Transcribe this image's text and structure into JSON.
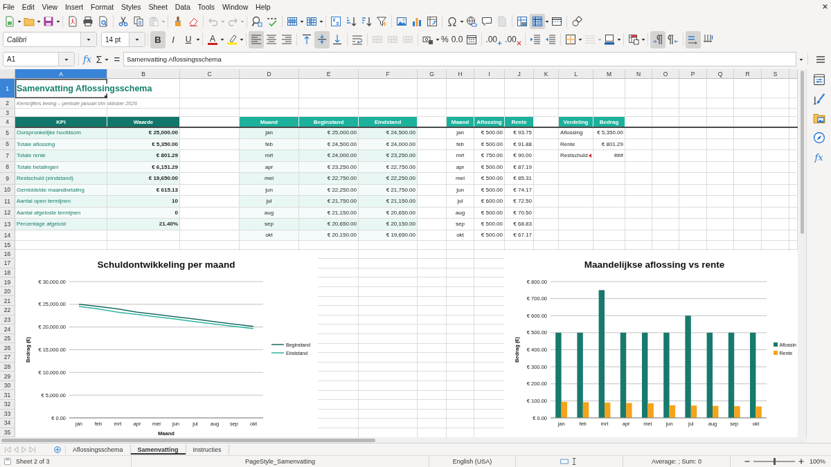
{
  "menu": [
    "File",
    "Edit",
    "View",
    "Insert",
    "Format",
    "Styles",
    "Sheet",
    "Data",
    "Tools",
    "Window",
    "Help"
  ],
  "standard_toolbar": {
    "paste": {
      "disabled": true
    },
    "undo": {
      "disabled": true
    },
    "redo": {
      "disabled": true
    },
    "header_footer": {
      "disabled": true
    },
    "freeze_rows_columns": {
      "on": true
    }
  },
  "formatting_toolbar": {
    "font_name": "Calibri",
    "font_size": "14 pt",
    "bold": {
      "label": "B",
      "on": true
    },
    "italic": {
      "label": "I",
      "on": false
    },
    "underline": {
      "label": "U",
      "on": false
    },
    "font_color": {
      "label": "A"
    },
    "align_left": {
      "on": true
    },
    "align_center": {
      "on": false
    },
    "align_right": {
      "on": false
    },
    "align_top": {
      "on": false
    },
    "align_center_vertically": {
      "on": true
    },
    "align_bottom": {
      "on": false
    },
    "merge_and_center": {
      "disabled": true
    },
    "merge_cells": {
      "disabled": true
    },
    "unmerge_cells": {
      "disabled": true
    },
    "percent": {
      "label": "%"
    },
    "number": {
      "label": "0.0"
    },
    "add_decimal_place": {
      "label": ".00"
    },
    "delete_decimal_place": {
      "label": ".00"
    },
    "border_style": {
      "disabled": true
    },
    "left_to_right": {
      "on": true
    },
    "right_to_left": {
      "on": false
    },
    "text_horizontal": {
      "on": true
    },
    "text_vertical": {
      "on": false
    }
  },
  "formula_bar": {
    "name_box": "A1",
    "function_wizard": "fx",
    "sum": "Σ",
    "equals": "=",
    "content": "Samenvatting Aflossingsschema"
  },
  "sidebar": {
    "functions": "fx"
  },
  "columns": [
    {
      "label": "A",
      "selected": true
    },
    {
      "label": "B",
      "selected": false
    },
    {
      "label": "C",
      "selected": false
    },
    {
      "label": "D",
      "selected": false
    },
    {
      "label": "E",
      "selected": false
    },
    {
      "label": "F",
      "selected": false
    },
    {
      "label": "G",
      "selected": false
    },
    {
      "label": "H",
      "selected": false
    },
    {
      "label": "I",
      "selected": false
    },
    {
      "label": "J",
      "selected": false
    },
    {
      "label": "K",
      "selected": false
    },
    {
      "label": "L",
      "selected": false
    },
    {
      "label": "M",
      "selected": false
    },
    {
      "label": "N",
      "selected": false
    },
    {
      "label": "O",
      "selected": false
    },
    {
      "label": "P",
      "selected": false
    },
    {
      "label": "Q",
      "selected": false
    },
    {
      "label": "R",
      "selected": false
    },
    {
      "label": "S",
      "selected": false
    }
  ],
  "rows": [
    {
      "label": "1",
      "selected": true
    },
    {
      "label": "2",
      "selected": false
    },
    {
      "label": "3",
      "selected": false
    },
    {
      "label": "4",
      "selected": false
    },
    {
      "label": "5",
      "selected": false
    },
    {
      "label": "6",
      "selected": false
    },
    {
      "label": "7",
      "selected": false
    },
    {
      "label": "8",
      "selected": false
    },
    {
      "label": "9",
      "selected": false
    },
    {
      "label": "10",
      "selected": false
    },
    {
      "label": "11",
      "selected": false
    },
    {
      "label": "12",
      "selected": false
    },
    {
      "label": "13",
      "selected": false
    },
    {
      "label": "14",
      "selected": false
    },
    {
      "label": "15",
      "selected": false
    },
    {
      "label": "16",
      "selected": false
    },
    {
      "label": "17",
      "selected": false
    },
    {
      "label": "18",
      "selected": false
    },
    {
      "label": "19",
      "selected": false
    },
    {
      "label": "20",
      "selected": false
    },
    {
      "label": "21",
      "selected": false
    },
    {
      "label": "22",
      "selected": false
    },
    {
      "label": "23",
      "selected": false
    },
    {
      "label": "24",
      "selected": false
    },
    {
      "label": "25",
      "selected": false
    },
    {
      "label": "26",
      "selected": false
    },
    {
      "label": "27",
      "selected": false
    },
    {
      "label": "28",
      "selected": false
    },
    {
      "label": "29",
      "selected": false
    },
    {
      "label": "30",
      "selected": false
    },
    {
      "label": "31",
      "selected": false
    },
    {
      "label": "32",
      "selected": false
    },
    {
      "label": "33",
      "selected": false
    },
    {
      "label": "34",
      "selected": false
    },
    {
      "label": "35",
      "selected": false
    }
  ],
  "title": "Samenvatting Aflossingsschema",
  "subtitle": "Kerncijfers lening – periode januari t/m oktober 2026",
  "kpi_table": {
    "columns": [
      "KPI",
      "Waarde"
    ],
    "rows": [
      [
        "Oorspronkelijke hoofdsom",
        "€ 25,000.00"
      ],
      [
        "Totale aflossing",
        "€ 5,350.00"
      ],
      [
        "Totale rente",
        "€ 801.29"
      ],
      [
        "Totale betalingen",
        "€ 6,151.29"
      ],
      [
        "Restschuld (eindstand)",
        "€ 19,650.00"
      ],
      [
        "Gemiddelde maandbetaling",
        "€ 615.13"
      ],
      [
        "Aantal open termijnen",
        "10"
      ],
      [
        "Aantal afgeloste termijnen",
        "0"
      ],
      [
        "Percentage afgelost",
        "21.40%"
      ]
    ]
  },
  "month_table": {
    "columns": [
      "Maand",
      "Beginstand",
      "Eindstand"
    ],
    "rows": [
      [
        "jan",
        "€ 25,000.00",
        "€ 24,500.00"
      ],
      [
        "feb",
        "€ 24,500.00",
        "€ 24,000.00"
      ],
      [
        "mrt",
        "€ 24,000.00",
        "€ 23,250.00"
      ],
      [
        "apr",
        "€ 23,250.00",
        "€ 22,750.00"
      ],
      [
        "mei",
        "€ 22,750.00",
        "€ 22,250.00"
      ],
      [
        "jun",
        "€ 22,250.00",
        "€ 21,750.00"
      ],
      [
        "jul",
        "€ 21,750.00",
        "€ 21,150.00"
      ],
      [
        "aug",
        "€ 21,150.00",
        "€ 20,650.00"
      ],
      [
        "sep",
        "€ 20,650.00",
        "€ 20,150.00"
      ],
      [
        "okt",
        "€ 20,150.00",
        "€ 19,650.00"
      ]
    ]
  },
  "payment_table": {
    "columns": [
      "Maand",
      "Aflossing",
      "Rente"
    ],
    "rows": [
      [
        "jan",
        "€ 500.00",
        "€ 93.75"
      ],
      [
        "feb",
        "€ 500.00",
        "€ 91.88"
      ],
      [
        "mrt",
        "€ 750.00",
        "€ 90.00"
      ],
      [
        "apr",
        "€ 500.00",
        "€ 87.19"
      ],
      [
        "mei",
        "€ 500.00",
        "€ 85.31"
      ],
      [
        "jun",
        "€ 500.00",
        "€ 74.17"
      ],
      [
        "jul",
        "€ 600.00",
        "€ 72.50"
      ],
      [
        "aug",
        "€ 500.00",
        "€ 70.50"
      ],
      [
        "sep",
        "€ 500.00",
        "€ 68.83"
      ],
      [
        "okt",
        "€ 500.00",
        "€ 67.17"
      ]
    ]
  },
  "split_table": {
    "columns": [
      "Verdeling",
      "Bedrag"
    ],
    "rows": [
      {
        "label": "Aflossing",
        "value": "€ 5,350.00",
        "clipped": false
      },
      {
        "label": "Rente",
        "value": "€ 801.29",
        "clipped": false
      },
      {
        "label": "Restschuld",
        "value": "###",
        "clipped": true
      }
    ]
  },
  "charts": [
    {
      "chart_data": {
        "type": "line",
        "title": "Schuldontwikkeling per maand",
        "xlabel": "Maand",
        "ylabel": "Bedrag (€)",
        "categories": [
          "jan",
          "feb",
          "mrt",
          "apr",
          "mei",
          "jun",
          "jul",
          "aug",
          "sep",
          "okt"
        ],
        "series": [
          {
            "name": "Beginstand",
            "color": "#1b6b62",
            "values": [
              25000,
              24500,
              24000,
              23250,
              22750,
              22250,
              21750,
              21150,
              20650,
              20150
            ]
          },
          {
            "name": "Eindstand",
            "color": "#2cb5a2",
            "values": [
              24500,
              24000,
              23250,
              22750,
              22250,
              21750,
              21150,
              20650,
              20150,
              19650
            ]
          }
        ],
        "ylim": [
          0,
          30000
        ],
        "yticks": [
          {
            "value": 0,
            "label": "€ 0.00"
          },
          {
            "value": 5000,
            "label": "€ 5,000.00"
          },
          {
            "value": 10000,
            "label": "€ 10,000.00"
          },
          {
            "value": 15000,
            "label": "€ 15,000.00"
          },
          {
            "value": 20000,
            "label": "€ 20,000.00"
          },
          {
            "value": 25000,
            "label": "€ 25,000.00"
          },
          {
            "value": 30000,
            "label": "€ 30,000.00"
          }
        ],
        "grid": true,
        "legend": true
      }
    },
    {
      "chart_data": {
        "type": "bar",
        "title": "Maandelijkse aflossing vs rente",
        "ylabel": "Bedrag (€)",
        "categories": [
          "jan",
          "feb",
          "mrt",
          "apr",
          "mei",
          "jun",
          "jul",
          "aug",
          "sep",
          "okt"
        ],
        "series": [
          {
            "name": "Aflossin",
            "color": "#177a6c",
            "values": [
              500,
              500,
              750,
              500,
              500,
              500,
              600,
              500,
              500,
              500
            ]
          },
          {
            "name": "Rente",
            "color": "#f5a31a",
            "values": [
              93.75,
              91.88,
              90,
              87.19,
              85.31,
              74.17,
              72.5,
              70.5,
              68.83,
              67.17
            ]
          }
        ],
        "ylim": [
          0,
          800
        ],
        "yticks": [
          {
            "value": 0,
            "label": "€ 0.00"
          },
          {
            "value": 100,
            "label": "€ 100.00"
          },
          {
            "value": 200,
            "label": "€ 200.00"
          },
          {
            "value": 300,
            "label": "€ 300.00"
          },
          {
            "value": 400,
            "label": "€ 400.00"
          },
          {
            "value": 500,
            "label": "€ 500.00"
          },
          {
            "value": 600,
            "label": "€ 600.00"
          },
          {
            "value": 700,
            "label": "€ 700.00"
          },
          {
            "value": 800,
            "label": "€ 800.00"
          }
        ],
        "grid": true,
        "legend": true
      }
    }
  ],
  "sheet_tabs": {
    "navigation_disabled": true,
    "tabs": [
      {
        "label": "Aflossingsschema",
        "selected": false
      },
      {
        "label": "Samenvatting",
        "selected": true
      },
      {
        "label": "Instructies",
        "selected": false
      }
    ]
  },
  "status_bar": {
    "sheet": "Sheet 2 of 3",
    "page_style": "PageStyle_Samenvatting",
    "language": "English (USA)",
    "summary": "Average: ; Sum: 0",
    "zoom_slider": {
      "level": 0.5
    },
    "zoom": "100%"
  }
}
